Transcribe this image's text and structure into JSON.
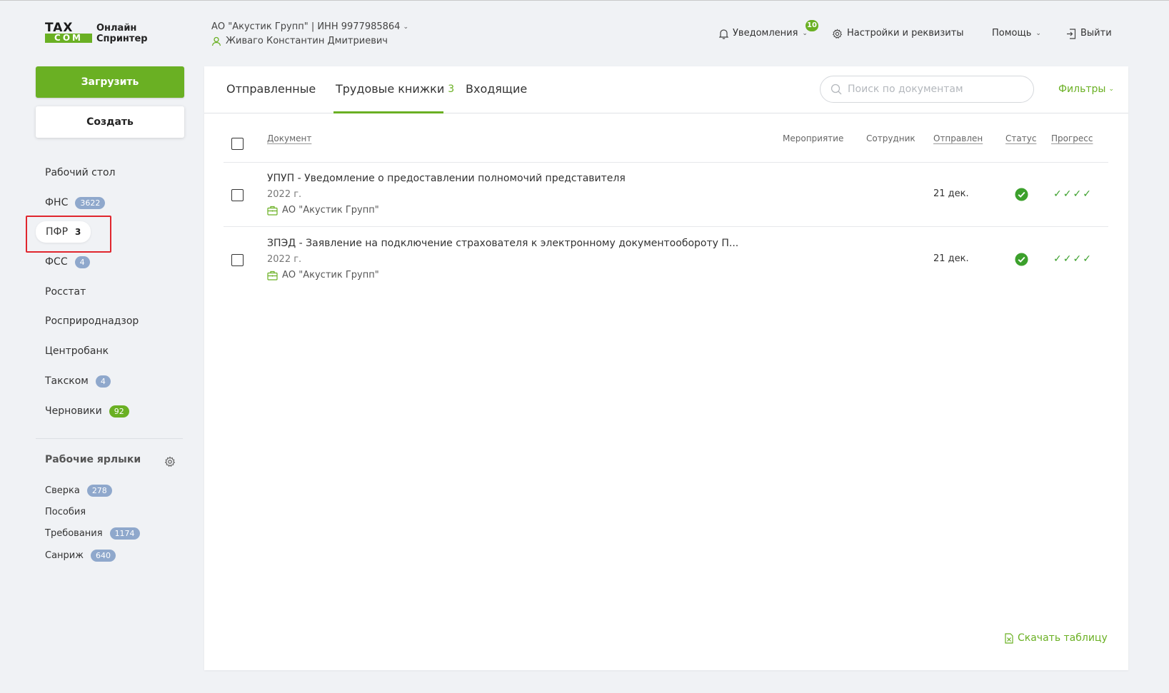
{
  "header": {
    "logo_top": "TAX",
    "logo_bottom": "COM",
    "logo_line1": "Онлайн",
    "logo_line2": "Спринтер",
    "organization": "АО \"Акустик Групп\" | ИНН 9977985864",
    "user_name": "Живаго Константин Дмитриевич",
    "notifications_label": "Уведомления",
    "notifications_count": "10",
    "settings_label": "Настройки и реквизиты",
    "help_label": "Помощь",
    "logout_label": "Выйти"
  },
  "sidebar": {
    "upload_label": "Загрузить",
    "create_label": "Создать",
    "items": [
      {
        "label": "Рабочий стол",
        "count": ""
      },
      {
        "label": "ФНС",
        "count": "3622"
      },
      {
        "label": "ПФР",
        "count": "3"
      },
      {
        "label": "ФСС",
        "count": "4"
      },
      {
        "label": "Росстат",
        "count": ""
      },
      {
        "label": "Росприроднадзор",
        "count": ""
      },
      {
        "label": "Центробанк",
        "count": ""
      },
      {
        "label": "Такском",
        "count": "4"
      },
      {
        "label": "Черновики",
        "count": "92"
      }
    ],
    "labels_title": "Рабочие ярлыки",
    "labels": [
      {
        "label": "Сверка",
        "count": "278"
      },
      {
        "label": "Пособия",
        "count": ""
      },
      {
        "label": "Требования",
        "count": "1174"
      },
      {
        "label": "Санриж",
        "count": "640"
      }
    ]
  },
  "main": {
    "tabs": [
      {
        "label": "Отправленные",
        "count": ""
      },
      {
        "label": "Трудовые книжки",
        "count": "3"
      },
      {
        "label": "Входящие",
        "count": ""
      }
    ],
    "active_tab": 1,
    "search_placeholder": "Поиск по документам",
    "filters_label": "Фильтры",
    "columns": {
      "document": "Документ",
      "event": "Мероприятие",
      "employee": "Сотрудник",
      "sent": "Отправлен",
      "status": "Статус",
      "progress": "Прогресс"
    },
    "rows": [
      {
        "title": "УПУП - Уведомление о предоставлении полномочий представителя",
        "year": "2022 г.",
        "org": "АО \"Акустик Групп\"",
        "sent": "21 дек.",
        "progress": "✓✓✓✓"
      },
      {
        "title": "ЗПЭД - Заявление на подключение страхователя к электронному документообороту П...",
        "year": "2022 г.",
        "org": "АО \"Акустик Групп\"",
        "sent": "21 дек.",
        "progress": "✓✓✓✓"
      }
    ],
    "download_label": "Скачать таблицу"
  },
  "colors": {
    "accent": "#6ab023",
    "badge": "#8fa8cc",
    "highlight": "#e0262e"
  }
}
